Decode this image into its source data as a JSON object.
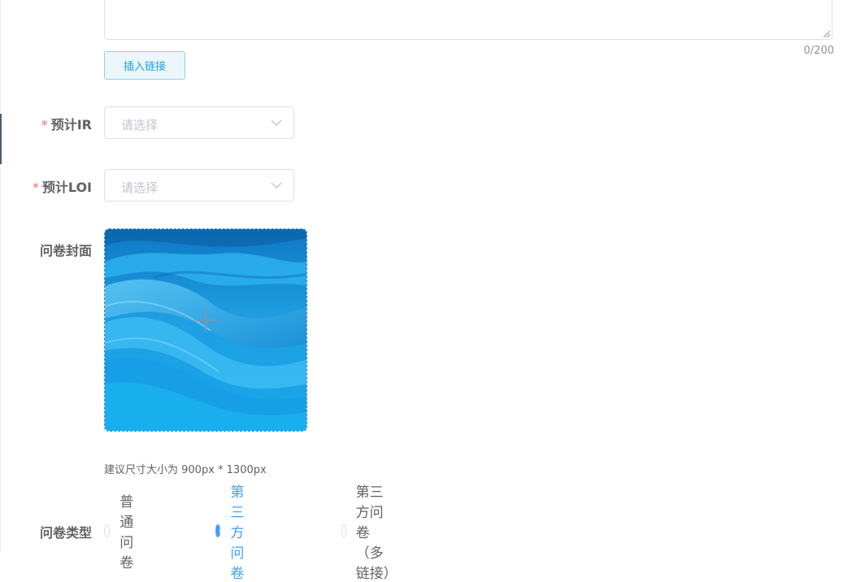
{
  "description": {
    "counter": "0/200",
    "insert_link_label": "插入链接"
  },
  "fields": {
    "ir": {
      "required_mark": "*",
      "label": "预计IR",
      "placeholder": "请选择"
    },
    "loi": {
      "required_mark": "*",
      "label": "预计LOI",
      "placeholder": "请选择"
    },
    "cover": {
      "label": "问卷封面",
      "hint": "建议尺寸大小为 900px * 1300px",
      "icon": "plus-icon"
    },
    "type": {
      "label": "问卷类型",
      "options": [
        {
          "label": "普通问卷",
          "checked": false
        },
        {
          "label": "第三方问卷",
          "checked": true
        },
        {
          "label": "第三方问卷（多链接）",
          "checked": false
        }
      ]
    }
  },
  "colors": {
    "primary": "#409eff",
    "required": "#f56c6c",
    "link_button_text": "#1aa2d8",
    "cover_blue": "#1aa0e0"
  }
}
